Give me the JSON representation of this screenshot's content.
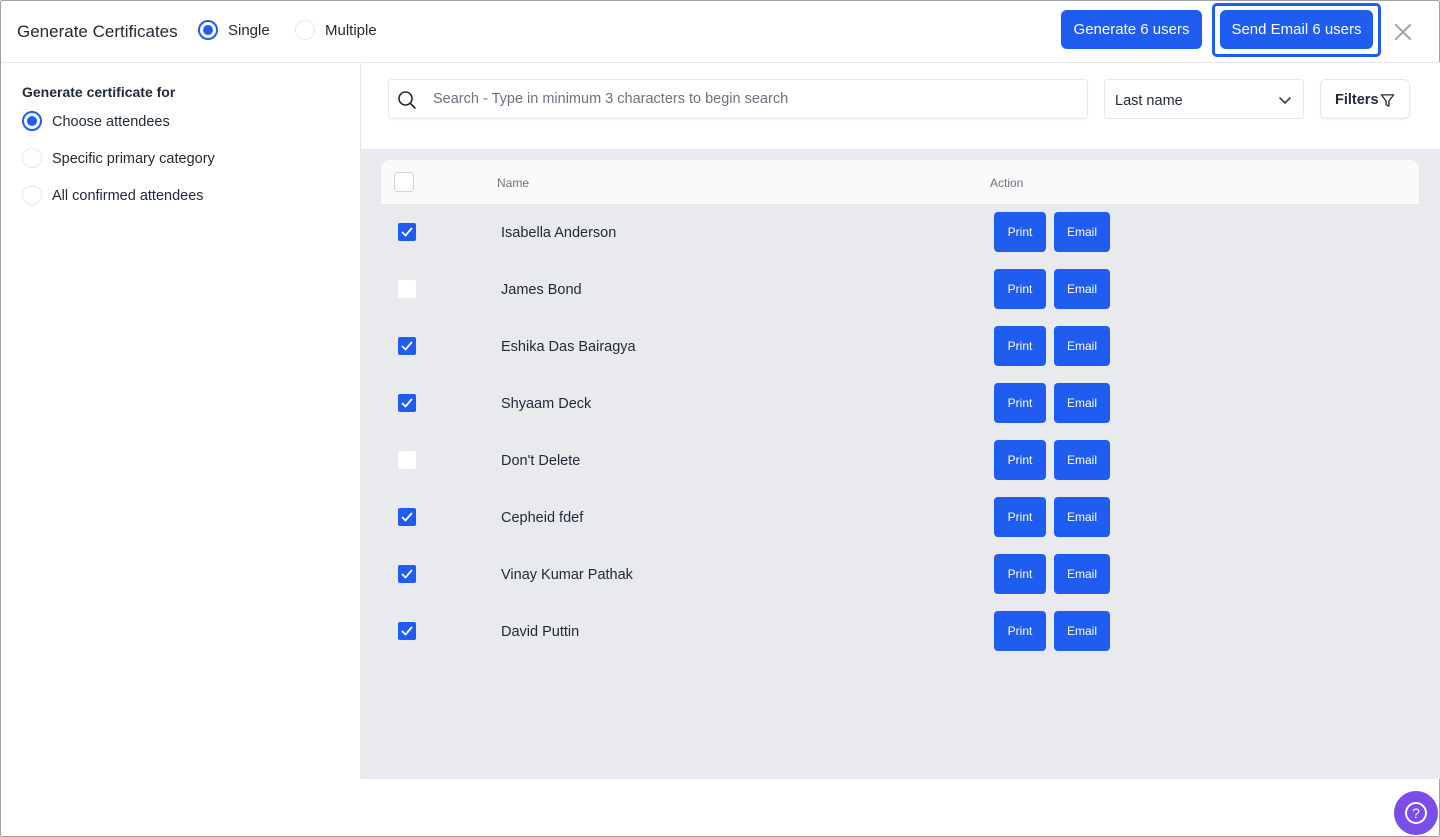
{
  "header": {
    "title": "Generate Certificates",
    "mode_options": [
      {
        "label": "Single",
        "checked": true
      },
      {
        "label": "Multiple",
        "checked": false
      }
    ],
    "generate_button": "Generate 6 users",
    "send_email_button": "Send Email 6 users"
  },
  "sidebar": {
    "heading": "Generate certificate for",
    "options": [
      {
        "label": "Choose attendees",
        "checked": true
      },
      {
        "label": "Specific primary category",
        "checked": false
      },
      {
        "label": "All confirmed attendees",
        "checked": false
      }
    ]
  },
  "toolbar": {
    "search_placeholder": "Search - Type in minimum 3 characters to begin search",
    "sort_value": "Last name",
    "filters_label": "Filters"
  },
  "table": {
    "columns": {
      "name": "Name",
      "action": "Action"
    },
    "print_label": "Print",
    "email_label": "Email",
    "rows": [
      {
        "name": "Isabella Anderson",
        "checked": true
      },
      {
        "name": "James Bond",
        "checked": false
      },
      {
        "name": "Eshika Das Bairagya",
        "checked": true
      },
      {
        "name": "Shyaam Deck",
        "checked": true
      },
      {
        "name": "Don't Delete",
        "checked": false
      },
      {
        "name": "Cepheid fdef",
        "checked": true
      },
      {
        "name": "Vinay Kumar Pathak",
        "checked": true
      },
      {
        "name": "David Puttin",
        "checked": true
      }
    ]
  },
  "help": {
    "glyph": "?"
  },
  "colors": {
    "primary": "#1f5cf0",
    "help": "#7b4de8",
    "table_bg": "#e9eaee"
  }
}
